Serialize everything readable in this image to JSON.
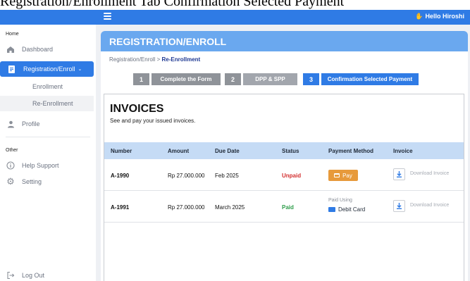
{
  "caption": "Registration/Enrollment Tab Confirmation Selected Payment",
  "topbar": {
    "greeting": "Hello Hiroshi",
    "greeting_icon": "waving-hand-icon"
  },
  "sidebar": {
    "section_home": "Home",
    "section_other": "Other",
    "items": {
      "dashboard": "Dashboard",
      "registration": "Registration/Enroll",
      "enrollment": "Enrollment",
      "re_enrollment": "Re-Enrollment",
      "profile": "Profile",
      "help": "Help Support",
      "setting": "Setting",
      "logout": "Log Out"
    }
  },
  "page": {
    "title": "REGISTRATION/ENROLL",
    "breadcrumb_root": "Registration/Enroll",
    "breadcrumb_sep": ">",
    "breadcrumb_current": "Re-Enrollment"
  },
  "steps": [
    {
      "num": "1",
      "label": "Complete the Form"
    },
    {
      "num": "2",
      "label": "DPP & SPP"
    },
    {
      "num": "3",
      "label": "Confirmation Selected Payment"
    }
  ],
  "invoices": {
    "title": "INVOICES",
    "subtitle": "See and pay your issued invoices.",
    "columns": [
      "Number",
      "Amount",
      "Due Date",
      "Status",
      "Payment Method",
      "Invoice"
    ],
    "rows": [
      {
        "number": "A-1990",
        "amount": "Rp 27.000.000",
        "due": "Feb 2025",
        "status": "Unpaid",
        "pay_label": "Pay",
        "download": "Download Invoice"
      },
      {
        "number": "A-1991",
        "amount": "Rp 27.000.000",
        "due": "March 2025",
        "status": "Paid",
        "paid_using": "Paid Using",
        "method": "Debit Card",
        "download": "Download Invoice"
      }
    ]
  },
  "colors": {
    "primary": "#2f7be5",
    "header": "#6aa8ef",
    "table_head": "#c5dbf5",
    "unpaid": "#d32f2f",
    "paid": "#2e9d4a",
    "pay_button": "#e79a3b",
    "step_inactive": "#8f9399",
    "step_active": "#2f7be5"
  }
}
